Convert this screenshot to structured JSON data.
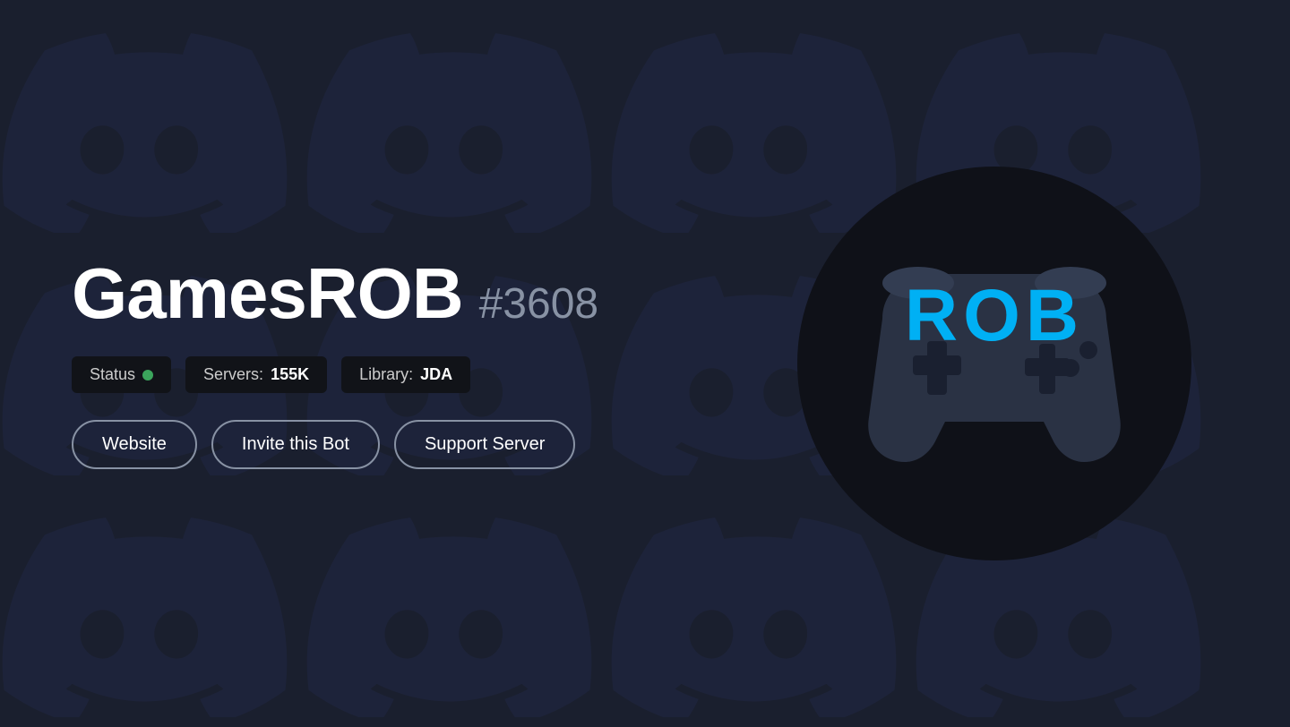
{
  "bot": {
    "name": "GamesROB",
    "discriminator": "#3608",
    "stats": {
      "status_label": "Status",
      "status_value": "online",
      "servers_label": "Servers:",
      "servers_value": "155K",
      "library_label": "Library:",
      "library_value": "JDA"
    },
    "buttons": {
      "website": "Website",
      "invite": "Invite this Bot",
      "support": "Support Server"
    }
  },
  "colors": {
    "background": "#1a1f2e",
    "badge_bg": "#111318",
    "status_online": "#3ba55c",
    "bot_avatar_bg": "#0f1118",
    "controller_color": "#2a3244",
    "rob_text_color": "#00b0f4",
    "border_color": "#8892a4"
  }
}
